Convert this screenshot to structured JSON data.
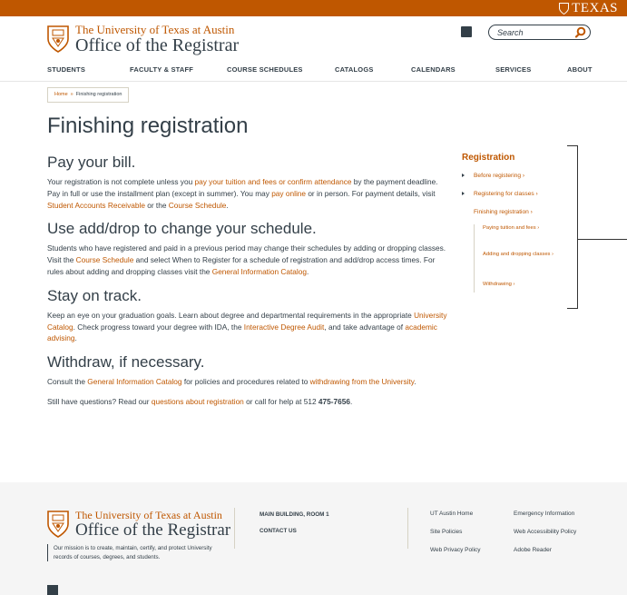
{
  "colors": {
    "accent": "#bf5700",
    "text": "#333f48"
  },
  "topbar": {
    "wordmark": "TEXAS"
  },
  "brand": {
    "university": "The University of Texas at Austin",
    "office": "Office of the Registrar"
  },
  "search": {
    "placeholder": "Search"
  },
  "nav": [
    "STUDENTS",
    "FACULTY & STAFF",
    "COURSE SCHEDULES",
    "CATALOGS",
    "CALENDARS",
    "SERVICES",
    "ABOUT"
  ],
  "breadcrumb": {
    "home": "Home",
    "sep": "»",
    "current": "Finishing registration"
  },
  "page_title": "Finishing registration",
  "sections": {
    "pay": {
      "heading": "Pay your bill.",
      "t1": "Your registration is not complete unless you ",
      "l1": "pay your tuition and fees or confirm attendance",
      "t2": " by the payment deadline. Pay in full or use the installment plan (except in summer). You may ",
      "l2": "pay online",
      "t3": " or in person. For payment details, visit ",
      "l3": "Student Accounts Receivable",
      "t4": " or the ",
      "l4": "Course Schedule",
      "t5": "."
    },
    "adddrop": {
      "heading": "Use add/drop to change your schedule.",
      "t1": "Students who have registered and paid in a previous period may change their schedules by adding or dropping classes. Visit the ",
      "l1": "Course Schedule",
      "t2": " and select When to Register for a schedule of registration and add/drop access times. For rules about adding and dropping classes visit the ",
      "l2": "General Information Catalog",
      "t3": "."
    },
    "track": {
      "heading": "Stay on track.",
      "t1": "Keep an eye on your graduation goals. Learn about degree and departmental requirements in the appropriate ",
      "l1": "University Catalog",
      "t2": ". Check progress toward your degree with IDA, the ",
      "l2": "Interactive Degree Audit",
      "t3": ", and take advantage of ",
      "l3": "academic advising",
      "t4": "."
    },
    "withdraw": {
      "heading": "Withdraw, if necessary.",
      "t1": "Consult the ",
      "l1": "General Information Catalog",
      "t2": " for policies and procedures related to ",
      "l2": "withdrawing from the University",
      "t3": "."
    },
    "questions": {
      "t1": "Still have questions? Read our ",
      "l1": "questions about registration",
      "t2": " or call for help at 512 ",
      "phone": "475-7656",
      "t3": "."
    }
  },
  "sidebar": {
    "title": "Registration",
    "items": [
      {
        "label": "Before registering ›"
      },
      {
        "label": "Registering for classes ›"
      },
      {
        "label": "Finishing registration ›"
      },
      {
        "label": "Paying tuition and fees ›"
      },
      {
        "label": "Adding and dropping classes ›"
      },
      {
        "label": "Withdrawing ›"
      }
    ]
  },
  "footer": {
    "university": "The University of Texas at Austin",
    "office": "Office of the Registrar",
    "mission": "Our mission is to create, maintain, certify, and protect University records of courses, degrees, and students.",
    "address": "MAIN BUILDING, ROOM 1",
    "contact": "CONTACT US",
    "links": [
      "UT Austin Home",
      "Emergency Information",
      "Site Policies",
      "Web Accessibility Policy",
      "Web Privacy Policy",
      "Adobe Reader"
    ]
  }
}
